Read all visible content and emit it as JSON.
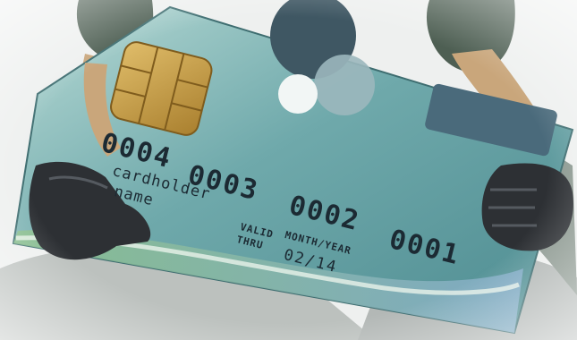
{
  "card": {
    "number_groups": [
      "0004",
      "0003",
      "0002",
      "0001"
    ],
    "holder_line1": "cardholder",
    "holder_line2": "name",
    "valid_thru_line1": "VALID",
    "valid_thru_line2": "THRU",
    "month_year_label": "MONTH/YEAR",
    "expiry": "02/14"
  },
  "colors": {
    "card_body": "#5f9ea0",
    "card_highlight": "#a8d0cc",
    "chip": "#c9a04a",
    "gloves": "#2c2f33",
    "sleeves": "#4d5d52",
    "arms": "#c8a479",
    "stripe_green": "#7fb07a",
    "stripe_blue": "#7aa4c4"
  }
}
